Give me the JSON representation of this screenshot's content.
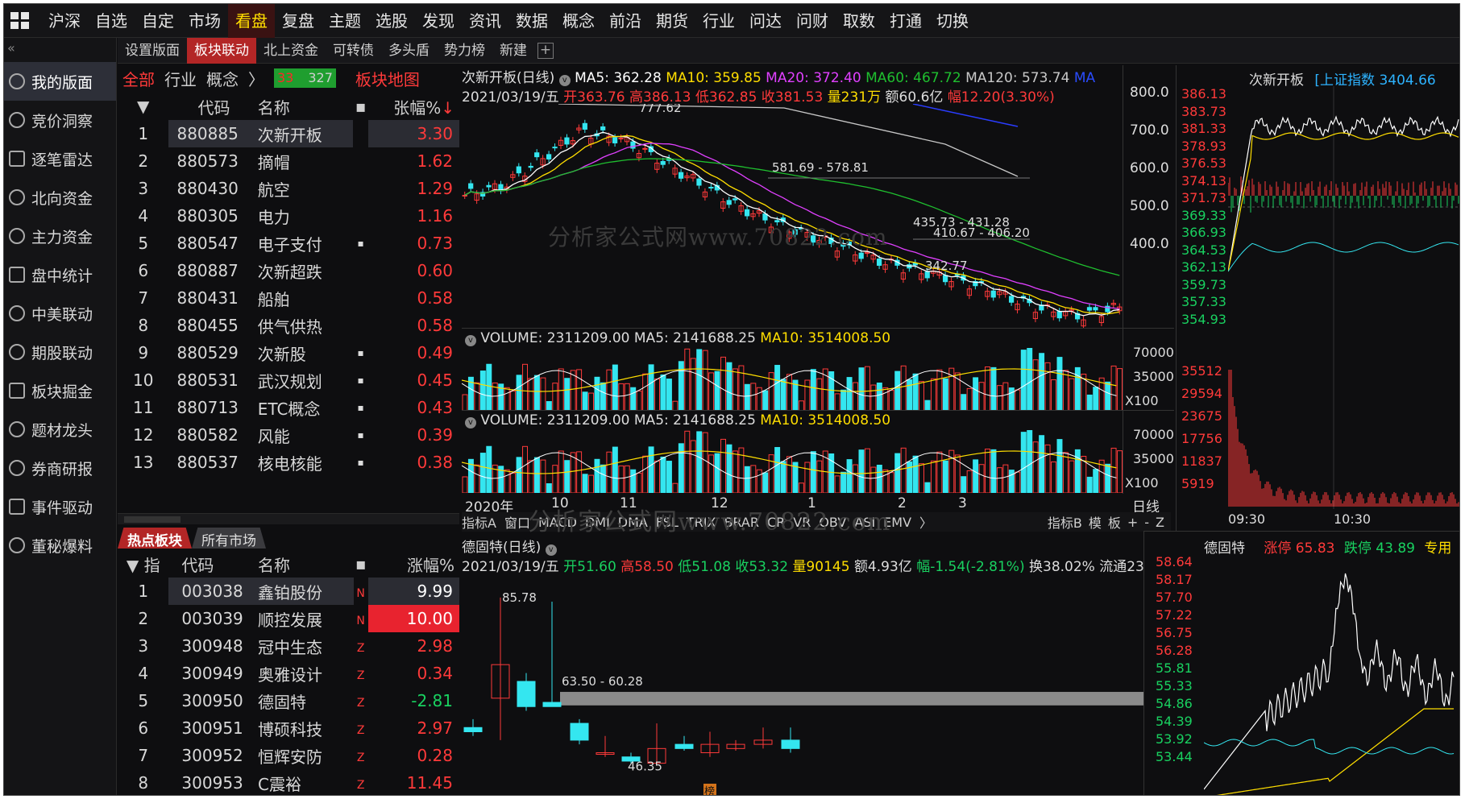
{
  "topbar": {
    "menu": [
      "沪深",
      "自选",
      "自定",
      "市场",
      "看盘",
      "复盘",
      "主题",
      "选股",
      "发现",
      "资讯",
      "数据",
      "概念",
      "前沿",
      "期货",
      "行业",
      "问达",
      "问财",
      "取数",
      "打通",
      "切换"
    ],
    "active": "看盘"
  },
  "leftnav": {
    "collapse": "«",
    "items": [
      "我的版面",
      "竞价洞察",
      "逐笔雷达",
      "北向资金",
      "主力资金",
      "盘中统计",
      "中美联动",
      "期股联动",
      "板块掘金",
      "题材龙头",
      "券商研报",
      "事件驱动",
      "董秘爆料"
    ]
  },
  "tabs": {
    "items": [
      "设置版面",
      "板块联动",
      "北上资金",
      "可转债",
      "多头盾",
      "势力榜",
      "新建"
    ],
    "active": "板块联动",
    "plus": "+"
  },
  "sector_panel": {
    "subtabs": {
      "all": "全部",
      "industry": "行业",
      "concept": "概念",
      "arrow": "〉",
      "up_count": "33",
      "down_count": "327",
      "map": "板块地图"
    },
    "headers": [
      "代码",
      "名称",
      "张幅%"
    ],
    "sort_arrow": "↓",
    "rows": [
      {
        "rank": "1",
        "code": "880885",
        "name": "次新开板",
        "dot": "",
        "chg": "3.30"
      },
      {
        "rank": "2",
        "code": "880573",
        "name": "摘帽",
        "dot": "",
        "chg": "1.62"
      },
      {
        "rank": "3",
        "code": "880430",
        "name": "航空",
        "dot": "",
        "chg": "1.29"
      },
      {
        "rank": "4",
        "code": "880305",
        "name": "电力",
        "dot": "",
        "chg": "1.16"
      },
      {
        "rank": "5",
        "code": "880547",
        "name": "电子支付",
        "dot": "▪",
        "chg": "0.73"
      },
      {
        "rank": "6",
        "code": "880887",
        "name": "次新超跌",
        "dot": "",
        "chg": "0.60"
      },
      {
        "rank": "7",
        "code": "880431",
        "name": "船舶",
        "dot": "",
        "chg": "0.58"
      },
      {
        "rank": "8",
        "code": "880455",
        "name": "供气供热",
        "dot": "",
        "chg": "0.58"
      },
      {
        "rank": "9",
        "code": "880529",
        "name": "次新股",
        "dot": "▪",
        "chg": "0.49"
      },
      {
        "rank": "10",
        "code": "880531",
        "name": "武汉规划",
        "dot": "▪",
        "chg": "0.45"
      },
      {
        "rank": "11",
        "code": "880713",
        "name": "ETC概念",
        "dot": "▪",
        "chg": "0.43"
      },
      {
        "rank": "12",
        "code": "880582",
        "name": "风能",
        "dot": "▪",
        "chg": "0.39"
      },
      {
        "rank": "13",
        "code": "880537",
        "name": "核电核能",
        "dot": "▪",
        "chg": "0.38"
      }
    ]
  },
  "stock_panel": {
    "tabs": [
      "热点板块",
      "所有市场"
    ],
    "headers": [
      "指",
      "代码",
      "名称",
      "涨幅%"
    ],
    "rows": [
      {
        "rank": "1",
        "code": "003038",
        "name": "鑫铂股份",
        "tag": "N",
        "chg": "9.99",
        "dir": "up",
        "hl": true
      },
      {
        "rank": "2",
        "code": "003039",
        "name": "顺控发展",
        "tag": "N",
        "chg": "10.00",
        "dir": "up",
        "hl": true
      },
      {
        "rank": "3",
        "code": "300948",
        "name": "冠中生态",
        "tag": "Z",
        "chg": "2.98",
        "dir": "up",
        "hl": false
      },
      {
        "rank": "4",
        "code": "300949",
        "name": "奥雅设计",
        "tag": "Z",
        "chg": "0.34",
        "dir": "up",
        "hl": false
      },
      {
        "rank": "5",
        "code": "300950",
        "name": "德固特",
        "tag": "Z",
        "chg": "-2.81",
        "dir": "dn",
        "hl": false
      },
      {
        "rank": "6",
        "code": "300951",
        "name": "博硕科技",
        "tag": "Z",
        "chg": "2.97",
        "dir": "up",
        "hl": false
      },
      {
        "rank": "7",
        "code": "300952",
        "name": "恒辉安防",
        "tag": "Z",
        "chg": "0.28",
        "dir": "up",
        "hl": false
      },
      {
        "rank": "8",
        "code": "300953",
        "name": "C震裕",
        "tag": "Z",
        "chg": "11.45",
        "dir": "up",
        "hl": false
      }
    ]
  },
  "kline_top": {
    "title": "次新开板(日线)",
    "ma5": "MA5: 362.28",
    "ma10": "MA10: 359.85",
    "ma20": "MA20: 372.40",
    "ma60": "MA60: 467.72",
    "ma120": "MA120: 573.74",
    "ma_more": "MA",
    "date": "2021/03/19/五",
    "open": "开363.76",
    "high": "高386.13",
    "low": "低362.85",
    "close": "收381.53",
    "vol": "量231万",
    "amt": "额60.6亿",
    "chg": "幅12.20(3.30%)",
    "yaxis": [
      "800.0",
      "700.0",
      "600.0",
      "500.0",
      "400.0"
    ],
    "annotations": [
      "777.62",
      "581.69 - 578.81",
      "435.73 - 431.28",
      "410.67 - 406.20",
      "342.77"
    ],
    "watermark": "分析家公式网www.70822.com"
  },
  "volume_panels": [
    {
      "label": "VOLUME: 2311209.00",
      "ma5": "MA5: 2141688.25",
      "ma10": "MA10: 3514008.50",
      "yaxis": [
        "70000",
        "35000"
      ],
      "unit": "X100"
    },
    {
      "label": "VOLUME: 2311209.00",
      "ma5": "MA5: 2141688.25",
      "ma10": "MA10: 3514008.50",
      "yaxis": [
        "70000",
        "35000"
      ],
      "unit": "X100"
    }
  ],
  "xaxis": {
    "labels": [
      "2020年",
      "10",
      "11",
      "12",
      "1",
      "2",
      "3"
    ],
    "period": "日线"
  },
  "indicator_bar": {
    "items": [
      "指标A",
      "窗口",
      "MACD",
      "DMI",
      "DMA",
      "FSL",
      "TRIX",
      "BRAR",
      "CR",
      "VR",
      "OBV",
      "ASI",
      "EMV",
      "〉"
    ],
    "right": [
      "指标B",
      "模",
      "板",
      "+",
      "-",
      "Z"
    ]
  },
  "watermark2": "分析家公式网www.70822.com",
  "intraday_top": {
    "title": "次新开板",
    "index": "[上证指数 3404.66",
    "prices": [
      "386.13",
      "383.73",
      "381.33",
      "378.93",
      "376.53",
      "374.13",
      "371.73",
      "369.33",
      "366.93",
      "364.53",
      "362.13",
      "359.73",
      "357.33",
      "354.93"
    ],
    "vols": [
      "35512",
      "29594",
      "23675",
      "17756",
      "11837",
      "5919"
    ],
    "times": [
      "09:30",
      "10:30"
    ]
  },
  "kline_bottom": {
    "title": "德固特(日线)",
    "date": "2021/03/19/五",
    "open": "开51.60",
    "high": "高58.50",
    "low": "低51.08",
    "close": "收53.32",
    "vol": "量90145",
    "amt": "额4.93亿",
    "chg": "幅-1.54(-2.81%)",
    "turn": "换38.02%",
    "float": "流通23",
    "annotations": [
      "85.78",
      "63.50 - 60.28",
      "46.35",
      "榜"
    ]
  },
  "intraday_bottom": {
    "title": "德固特",
    "up": "涨停 65.83",
    "down": "跌停 43.89",
    "special": "专用",
    "prices": [
      "58.64",
      "58.17",
      "57.70",
      "57.22",
      "56.75",
      "56.28",
      "55.81",
      "55.33",
      "54.86",
      "54.39",
      "53.92",
      "53.44"
    ]
  },
  "colors": {
    "up": "#ff3a3a",
    "down": "#19d160",
    "ma5": "#ffffff",
    "ma10": "#ffde00",
    "ma20": "#e040ff",
    "ma60": "#1fbf2f",
    "ma120": "#c8c8c8",
    "accent": "#b32626"
  }
}
